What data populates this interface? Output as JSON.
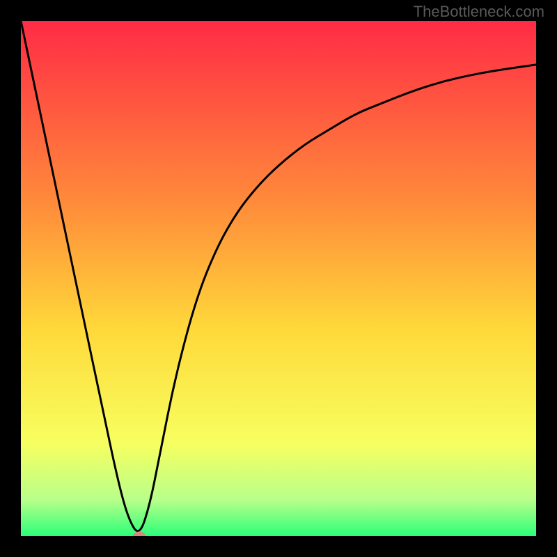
{
  "watermark": "TheBottleneck.com",
  "chart_data": {
    "type": "line",
    "title": "",
    "xlabel": "",
    "ylabel": "",
    "xlim": [
      0,
      100
    ],
    "ylim": [
      0,
      100
    ],
    "gradient_stops": [
      {
        "offset": 0,
        "color": "#ff2b45"
      },
      {
        "offset": 35,
        "color": "#ff8a3a"
      },
      {
        "offset": 60,
        "color": "#ffd93a"
      },
      {
        "offset": 82,
        "color": "#f7ff60"
      },
      {
        "offset": 93,
        "color": "#b8ff8a"
      },
      {
        "offset": 100,
        "color": "#2bff78"
      }
    ],
    "series": [
      {
        "name": "bottleneck-curve",
        "x": [
          0,
          4,
          8,
          12,
          16,
          19,
          21,
          23,
          25,
          27,
          30,
          34,
          38,
          42,
          46,
          50,
          55,
          60,
          65,
          70,
          75,
          80,
          85,
          90,
          95,
          100
        ],
        "y": [
          100,
          81,
          62,
          43,
          24,
          10,
          3,
          0,
          6,
          16,
          31,
          46,
          56,
          63,
          68,
          72,
          76,
          79,
          82,
          84,
          86,
          87.7,
          89,
          90,
          90.8,
          91.5
        ]
      }
    ],
    "marker": {
      "x": 23,
      "y": 0,
      "name": "optimal-point"
    }
  }
}
